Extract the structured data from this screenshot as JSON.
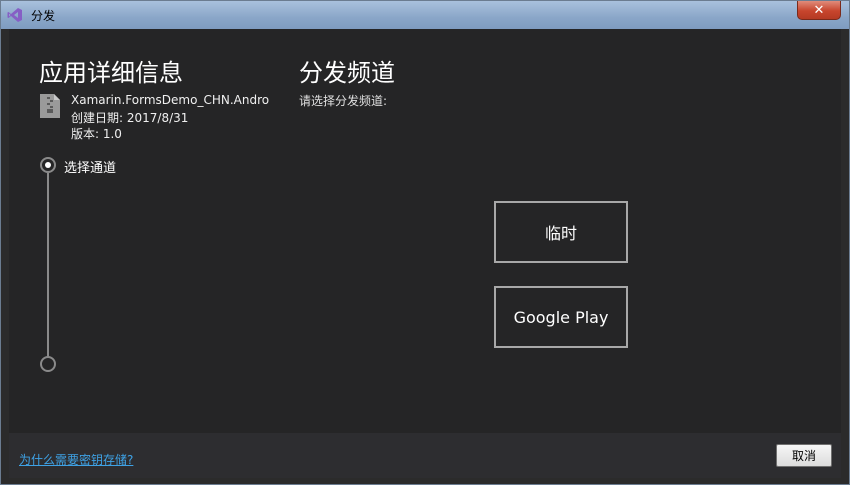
{
  "window": {
    "title": "分发",
    "close_label": "✕"
  },
  "app_details": {
    "heading": "应用详细信息",
    "package_name": "Xamarin.FormsDemo_CHN.Android",
    "created_date": "创建日期: 2017/8/31",
    "version": "版本: 1.0"
  },
  "steps": [
    {
      "label": "选择通道",
      "active": true
    },
    {
      "label": "",
      "active": false
    }
  ],
  "channel": {
    "heading": "分发频道",
    "prompt": "请选择分发频道:",
    "options": [
      {
        "label": "临时"
      },
      {
        "label": "Google Play"
      }
    ]
  },
  "footer": {
    "help_link": "为什么需要密钥存储?",
    "cancel_label": "取消"
  },
  "colors": {
    "background": "#252526",
    "footer": "#2d2d30",
    "link": "#3ea2e6",
    "vs_purple": "#865fc5"
  }
}
